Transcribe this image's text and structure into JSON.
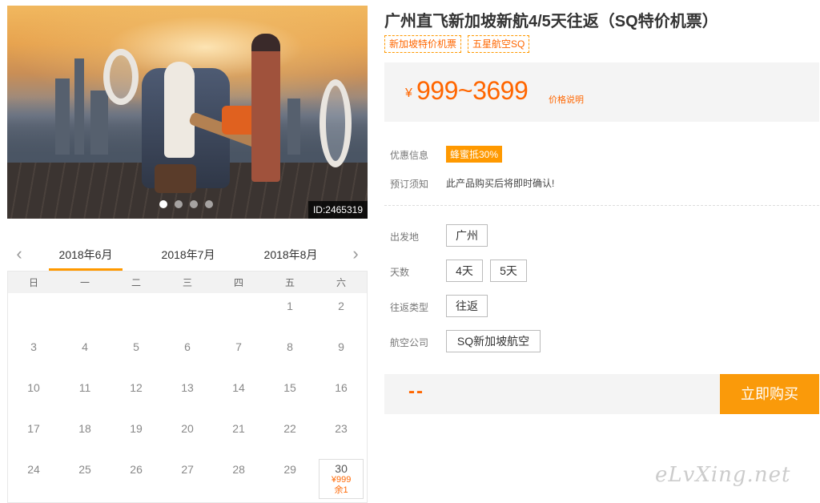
{
  "hero": {
    "id_badge": "ID:2465319",
    "slides": [
      true,
      false,
      false,
      false
    ]
  },
  "calendar": {
    "months": [
      "2018年6月",
      "2018年7月",
      "2018年8月"
    ],
    "active_month_index": 0,
    "prev_icon": "chevron-left-icon",
    "next_icon": "chevron-right-icon",
    "weekdays": [
      "日",
      "一",
      "二",
      "三",
      "四",
      "五",
      "六"
    ],
    "rows": [
      [
        "",
        "",
        "",
        "",
        "",
        "1",
        "2"
      ],
      [
        "3",
        "4",
        "5",
        "6",
        "7",
        "8",
        "9"
      ],
      [
        "10",
        "11",
        "12",
        "13",
        "14",
        "15",
        "16"
      ],
      [
        "17",
        "18",
        "19",
        "20",
        "21",
        "22",
        "23"
      ],
      [
        "24",
        "25",
        "26",
        "27",
        "28",
        "29",
        "30"
      ]
    ],
    "special_day": {
      "day": "30",
      "price": "¥999",
      "stock": "余1"
    }
  },
  "product": {
    "title": "广州直飞新加坡新航4/5天往返（SQ特价机票）",
    "tags": [
      "新加坡特价机票",
      "五星航空SQ"
    ],
    "price": {
      "currency": "¥",
      "amount": "999~3699",
      "explain": "价格说明"
    },
    "promo_label": "优惠信息",
    "promo_badge": "蜂蜜抵30%",
    "notice_label": "预订须知",
    "notice_text": "此产品购买后将即时确认!",
    "options": {
      "origin_label": "出发地",
      "origin_values": [
        "广州"
      ],
      "days_label": "天数",
      "days_values": [
        "4天",
        "5天"
      ],
      "trip_label": "往返类型",
      "trip_values": [
        "往返"
      ],
      "airline_label": "航空公司",
      "airline_values": [
        "SQ新加坡航空"
      ]
    },
    "total_placeholder": "--",
    "buy_button": "立即购买"
  },
  "watermark": "eLvXing.net",
  "colors": {
    "accent": "#ff6600",
    "button": "#fa9a0a"
  }
}
